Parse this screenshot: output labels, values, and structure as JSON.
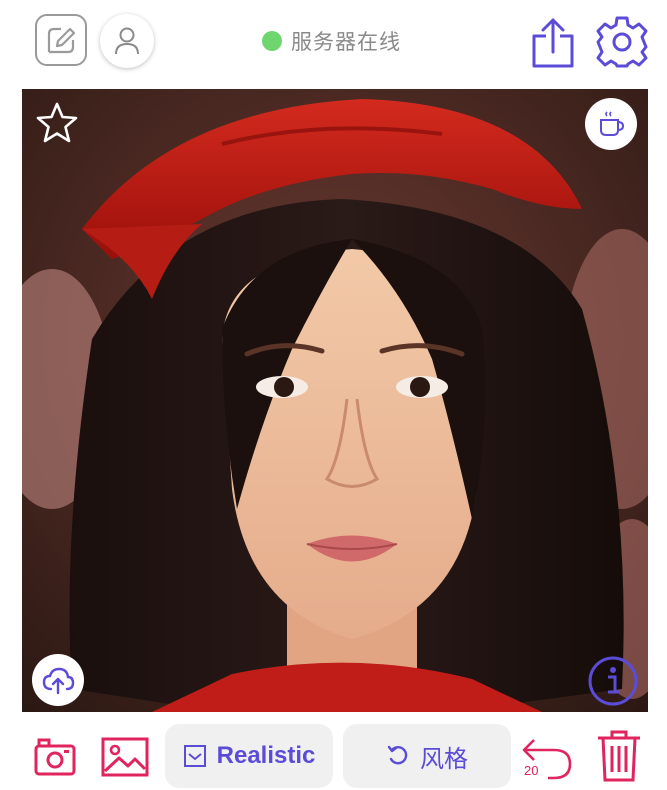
{
  "status": {
    "text": "服务器在线",
    "color": "#6fd66f"
  },
  "toolbar": {
    "model_label": "Realistic",
    "style_label": "风格",
    "undo_count": "20"
  },
  "colors": {
    "accent": "#5b4cd8",
    "danger": "#e0245e"
  },
  "icons": {
    "edit": "edit-icon",
    "user": "user-icon",
    "share": "share-icon",
    "settings": "gear-icon",
    "favorite": "star-icon",
    "coffee": "coffee-icon",
    "upload": "cloud-upload-icon",
    "info": "info-icon",
    "camera": "camera-icon",
    "gallery": "image-icon",
    "model": "checkbox-icon",
    "style": "rotate-icon",
    "undo": "undo-icon",
    "delete": "trash-icon"
  }
}
